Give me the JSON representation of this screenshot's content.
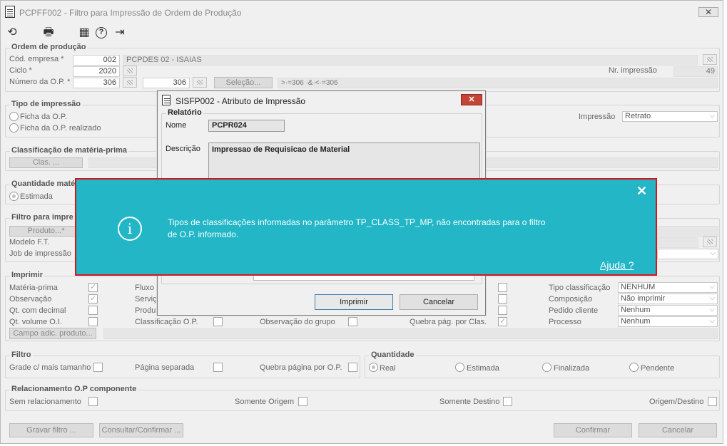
{
  "window": {
    "title": "PCPFF002 - Filtro para Impressão de Ordem de Produção",
    "close_label": "✕"
  },
  "toolbar": {
    "refresh": "⟲",
    "print": "🖶",
    "calendar": "▦",
    "help": "?",
    "exit": "⇥"
  },
  "ordem": {
    "title": "Ordem de produção",
    "empresa_label": "Cód. empresa *",
    "empresa_value": "002",
    "empresa_desc": "PCPDES 02 - ISAIAS",
    "ciclo_label": "Ciclo *",
    "ciclo_value": "2020",
    "nr_impressao_label": "Nr. impressão",
    "nr_impressao_value": "49",
    "numero_op_label": "Número da O.P. *",
    "numero_op_from": "306",
    "numero_op_to": "306",
    "selecao_label": "Seleção...",
    "selecao_value": ">·=306 ·&·<·=306"
  },
  "tipo": {
    "title": "Tipo de impressão",
    "opt1": "Ficha da O.P.",
    "opt2": "Ficha da O.P. realizado",
    "impressao_label": "Impressão",
    "impressao_value": "Retrato"
  },
  "classif": {
    "title": "Classificação de matéria-prima",
    "btn": "Clas. ..."
  },
  "quantidade_mat": {
    "title": "Quantidade maté",
    "opt": "Estimada"
  },
  "filtro_imp": {
    "title": "Filtro para impre",
    "produto_btn": "Produto...*",
    "modelo": "Modelo F.T.",
    "job": "Job de impressão"
  },
  "imprimir": {
    "title": "Imprimir",
    "materia": "Matéria-prima",
    "observacao": "Observação",
    "qt_decimal": "Qt. com decimal",
    "qt_volume": "Qt. volume O.I.",
    "fluxo": "Fluxo p",
    "servico": "Serviço",
    "produto": "Produt",
    "classif_op": "Classificação O.P.",
    "obs_grupo": "Observação do grupo",
    "quebra_clas": "Quebra pág. por Clas.",
    "tipo_clas": "Tipo classificação",
    "tipo_clas_value": "NENHUM",
    "composicao": "Composição",
    "composicao_value": "Não imprimir",
    "pedido": "Pedido cliente",
    "pedido_value": "Nenhum",
    "processo": "Processo",
    "processo_value": "Nenhum",
    "campo_adic": "Campo adic. produto..."
  },
  "filtro": {
    "title": "Filtro",
    "grade": "Grade c/ mais tamanho",
    "pagina": "Página separada",
    "quebra": "Quebra página por O.P."
  },
  "quantidade": {
    "title": "Quantidade",
    "real": "Real",
    "estimada": "Estimada",
    "finalizada": "Finalizada",
    "pendente": "Pendente"
  },
  "relac": {
    "title": "Relacionamento O.P componente",
    "sem": "Sem relacionamento",
    "origem": "Somente Origem",
    "destino": "Somente Destino",
    "orig_dest": "Origem/Destino"
  },
  "footer": {
    "gravar": "Gravar filtro ...",
    "consultar": "Consultar/Confirmar ...",
    "confirmar": "Confirmar",
    "cancelar": "Cancelar"
  },
  "dialog": {
    "title": "SISFP002 - Atributo de Impressão",
    "close": "✕",
    "group": "Relatório",
    "nome_label": "Nome",
    "nome_value": "PCPR024",
    "descricao_label": "Descrição",
    "descricao_value": "Impressao de Requisicao de Material",
    "imprimir": "Imprimir",
    "cancelar": "Cancelar"
  },
  "toast": {
    "message_line1": "Tipos de classificações informadas no parâmetro TP_CLASS_TP_MP, não encontradas para o filtro",
    "message_line2": "de O.P. informado.",
    "help": "Ajuda ?",
    "close": "✕"
  }
}
